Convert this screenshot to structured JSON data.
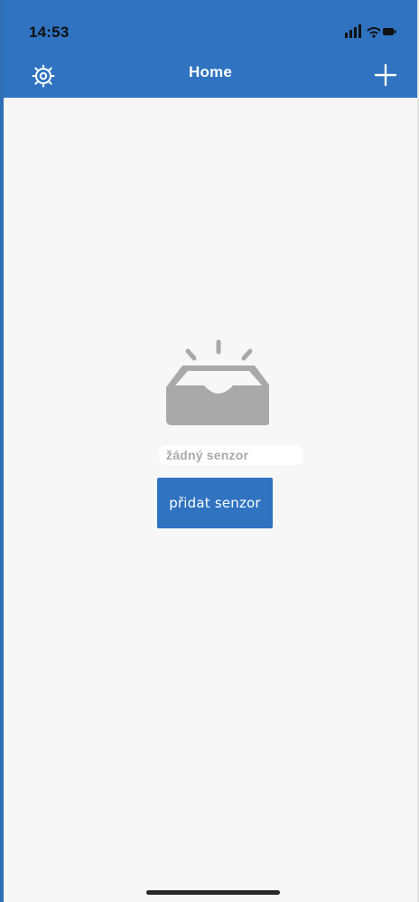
{
  "status_bar": {
    "time": "14:53"
  },
  "nav": {
    "title": "Home",
    "left_icon": "gear-icon",
    "right_icon": "plus-icon"
  },
  "empty_state": {
    "message": "žádný senzor",
    "action_label": "přidat senzor",
    "illustration": "empty-inbox-icon"
  },
  "colors": {
    "primary": "#2f73c1",
    "background": "#f7f7f7",
    "muted": "#a9a9a9"
  }
}
